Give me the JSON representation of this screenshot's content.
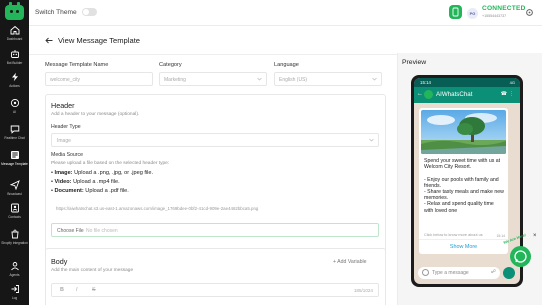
{
  "sidebar": {
    "items": [
      {
        "label": "Dashboard",
        "icon": "home-icon"
      },
      {
        "label": "Bot Builder",
        "icon": "bot-icon"
      },
      {
        "label": "Actions",
        "icon": "bolt-icon"
      },
      {
        "label": "AI",
        "icon": "ai-icon"
      },
      {
        "label": "Realtime Chat",
        "icon": "chat-icon"
      },
      {
        "label": "Message Template",
        "icon": "template-icon"
      },
      {
        "label": "Broadcast",
        "icon": "send-icon"
      },
      {
        "label": "Contacts",
        "icon": "contacts-icon"
      },
      {
        "label": "Shopify Integration",
        "icon": "shopify-icon"
      },
      {
        "label": "Agents",
        "icon": "agents-icon"
      },
      {
        "label": "Log",
        "icon": "log-icon"
      }
    ],
    "active_index": 5
  },
  "topbar": {
    "switch_label": "Switch Theme",
    "status": "CONNECTED",
    "number": "+15554443737",
    "avatar_initials": "PG"
  },
  "main": {
    "title": "View Message Template",
    "fields": {
      "name_label": "Message Template Name",
      "name_value": "welcome_city",
      "category_label": "Category",
      "category_value": "Marketing",
      "language_label": "Language",
      "language_value": "English (US)"
    },
    "header": {
      "title": "Header",
      "subtitle": "Add a header to your message (optional).",
      "type_label": "Header Type",
      "type_value": "Image",
      "media_title": "Media Source",
      "media_subtitle": "Please upload a file based on the selected header type:",
      "bullets": [
        {
          "label": "Image:",
          "text": " Upload a .png, .jpg, or .jpeg file."
        },
        {
          "label": "Video:",
          "text": " Upload a .mp4 file."
        },
        {
          "label": "Document:",
          "text": " Upload a .pdf file."
        }
      ],
      "url": "https://aiwhatschat.s3.us-east-1.amazonaws.com/image_1769bdee-0bf2-41cd-909e-2ae4462bbca5.png",
      "choose_file": "Choose File",
      "no_file": "No file chosen"
    },
    "body": {
      "title": "Body",
      "subtitle": "Add the main content of your message",
      "add_variable": "+ Add Variable",
      "counter": "185/1024",
      "toolbar": [
        "B",
        "I",
        "S"
      ]
    }
  },
  "preview": {
    "title": "Preview",
    "time": "15:14",
    "signal": "4G",
    "chat_name": "AIWhatsChat",
    "message": "Spend your sweet time with us at Welcom City Resort.\n\n- Enjoy our pools with family and friends.\n- Share tasty meals and make new memories.\n- Relax and spend quality time with loved one",
    "footer": "Click below to know more about us",
    "msg_time": "15:14",
    "show_more": "Show More",
    "input_placeholder": "Type a message"
  },
  "widget": {
    "label": "We Are Here!",
    "close": "×"
  }
}
